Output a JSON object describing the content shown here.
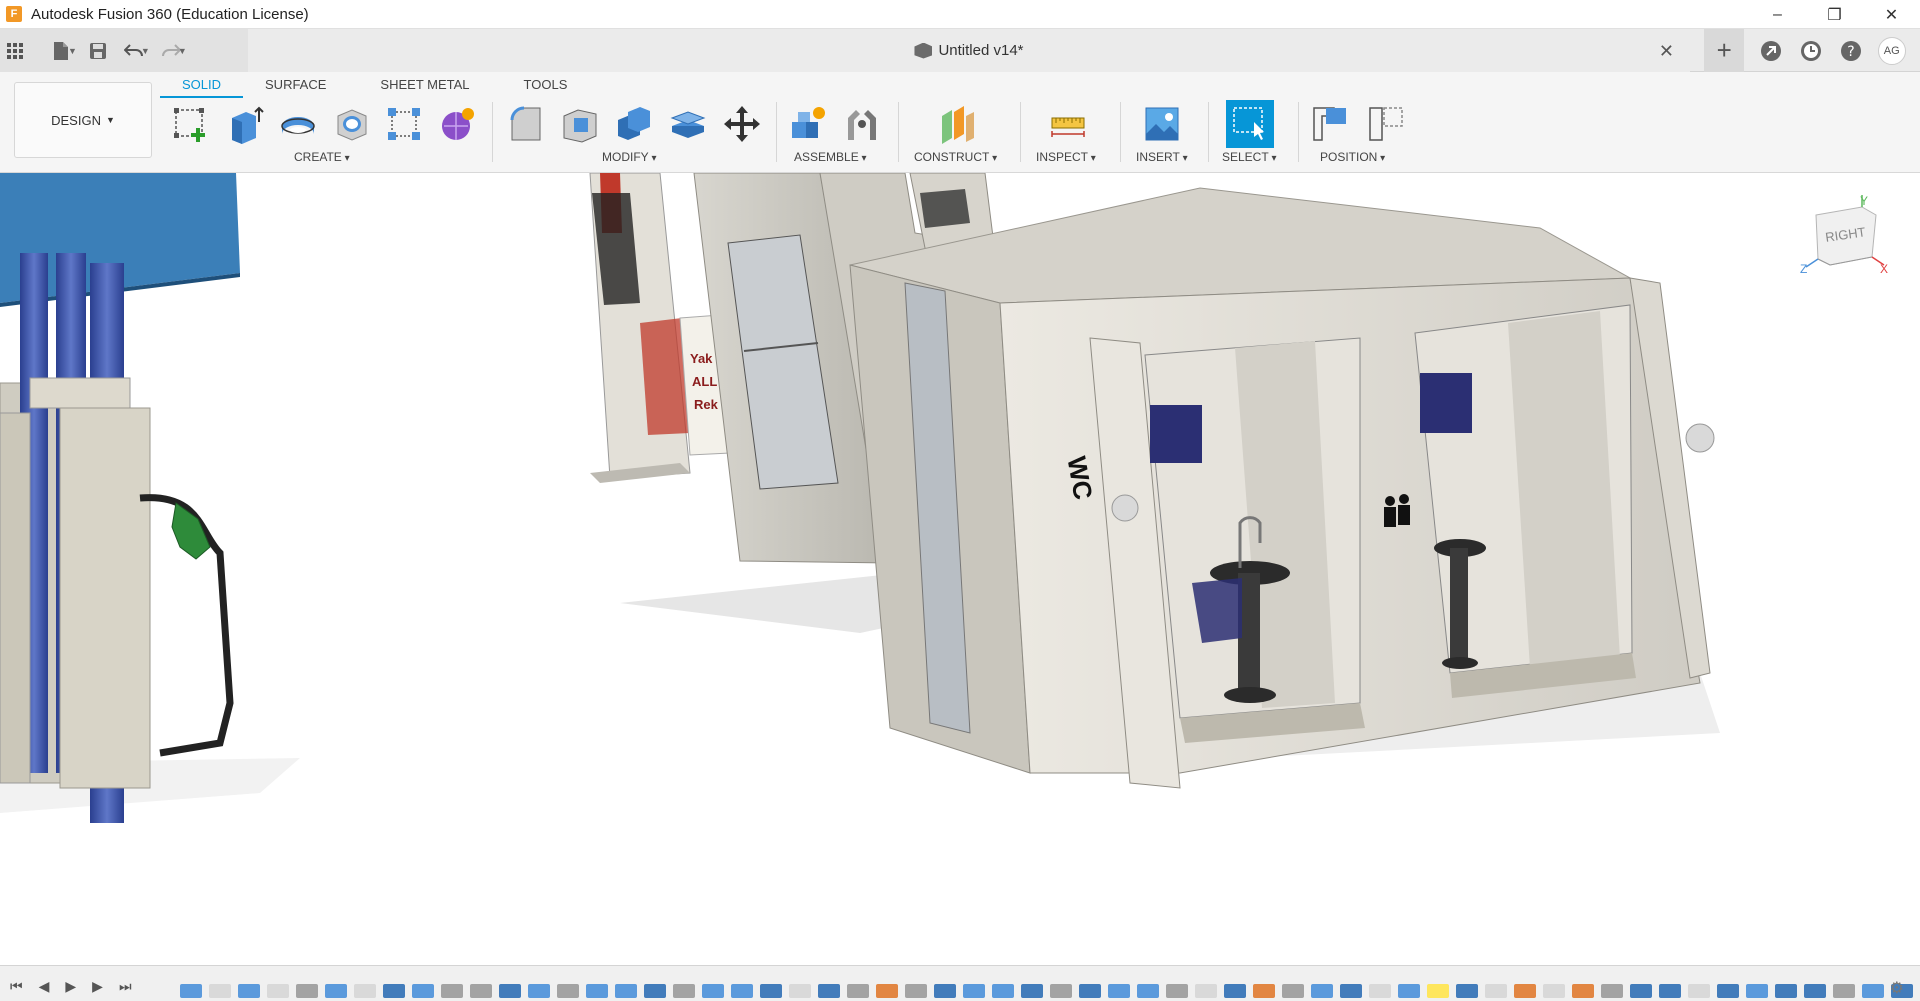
{
  "window": {
    "title": "Autodesk Fusion 360 (Education License)",
    "app_logo_letter": "F",
    "controls": [
      "–",
      "❐",
      "✕"
    ]
  },
  "document": {
    "title": "Untitled v14*",
    "close_glyph": "✕"
  },
  "user": {
    "initials": "AG"
  },
  "workspace": {
    "label": "DESIGN"
  },
  "tabs": [
    {
      "label": "SOLID",
      "active": true
    },
    {
      "label": "SURFACE",
      "active": false
    },
    {
      "label": "SHEET METAL",
      "active": false
    },
    {
      "label": "TOOLS",
      "active": false
    }
  ],
  "groups": {
    "create": "CREATE",
    "modify": "MODIFY",
    "assemble": "ASSEMBLE",
    "construct": "CONSTRUCT",
    "inspect": "INSPECT",
    "insert": "INSERT",
    "select": "SELECT",
    "position": "POSITION"
  },
  "viewcube": {
    "face": "RIGHT",
    "axis_y": "Y",
    "axis_z": "Z",
    "axis_x": "X"
  },
  "scene": {
    "restroom_sign": "WC",
    "store_sign": "Yak ALL Rek"
  },
  "colors": {
    "accent": "#0696d7",
    "selected_tool": "#0696d7",
    "timeline_highlight": "#ffe44d"
  }
}
